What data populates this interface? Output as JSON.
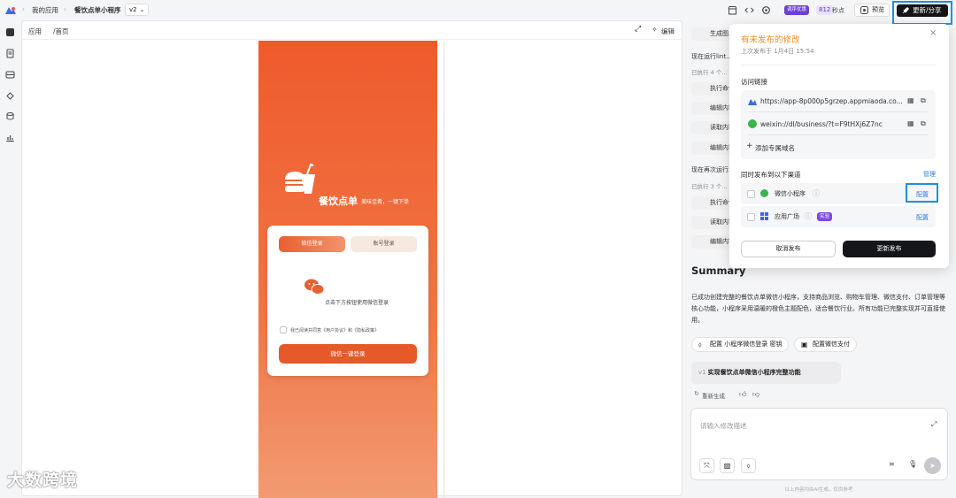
{
  "topbar": {
    "crumb_apps": "我的应用",
    "app_name": "餐饮点单小程序",
    "version": "v2",
    "priority_badge": "调序优惠",
    "points_value": "812",
    "points_label": "秒点",
    "preview_label": "预览",
    "share_label": "更新/分享"
  },
  "preview": {
    "tab_app": "应用",
    "tab_path": "/首页",
    "edit_label": "编辑",
    "phone": {
      "brand_title": "餐饮点单",
      "brand_slogan": "美味佳肴，一键下单",
      "tab_wechat": "微信登录",
      "tab_account": "账号登录",
      "hint": "点击下方按钮使用微信登录",
      "agree_text": "我已阅读并同意《用户协议》和《隐私政策》",
      "main_button": "微信一键登录"
    }
  },
  "chat": {
    "item_generate": "生成图...",
    "running_1": "现在运行lint...",
    "executed_1": "已执行 4 个...",
    "items_1": [
      "执行命令...",
      "编辑内容...",
      "读取内容...",
      "编辑内容..."
    ],
    "running_2": "现在再次运行...",
    "executed_2": "已执行 3 个...",
    "items_2": [
      "执行命令...",
      "读取内容...",
      "编辑内容..."
    ],
    "summary_title": "Summary",
    "summary_text": "已成功创建完整的餐饮点单微信小程序，支持商品浏览、购物车管理、微信支付、订单管理等核心功能，小程序采用温暖的橙色主题配色，适合餐饮行业。所有功能已完整实现并可直接使用。",
    "pill_1": "配置 小程序微信登录 密钥",
    "pill_2": "配置微信支付",
    "version_tag": "v1",
    "version_title": "实现餐饮点单微信小程序完整功能",
    "regenerate": "重新生成",
    "input_placeholder": "请输入修改描述",
    "disclaimer": "以上内容均由AI生成，仅供参考"
  },
  "popover": {
    "title": "有未发布的修改",
    "last_publish": "上次发布于 1月4日 15:54",
    "access_link_label": "访问链接",
    "link_1": "https://app-8p000p5grzep.appmiaoda.co...",
    "link_2": "weixin://dl/business/?t=F9tHXj6Z7nc",
    "add_domain": "添加专属域名",
    "channels_label": "同时发布到以下渠道",
    "manage": "管理",
    "channel_1": "微信小程序",
    "channel_2": "应用广场",
    "channel_2_badge": "实验",
    "configure": "配置",
    "cancel": "取消发布",
    "update": "更新发布"
  },
  "watermark": "大数跨境",
  "colors": {
    "accent_orange": "#ef5a2c",
    "title_orange": "#ef8b1f",
    "highlight_blue": "#1e8fe0",
    "link_blue": "#2f7ae5"
  }
}
